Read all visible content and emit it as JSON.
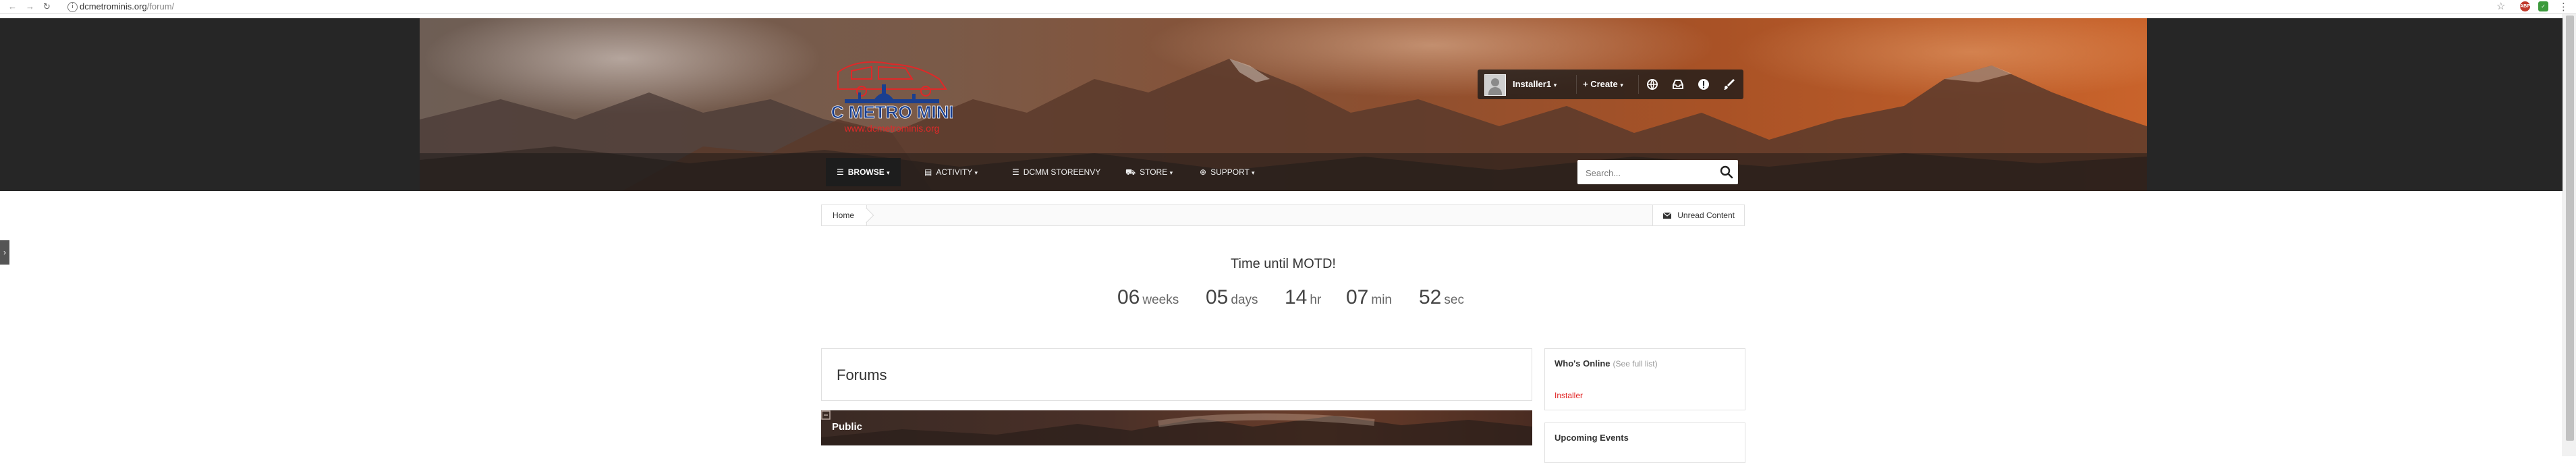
{
  "browser": {
    "url_domain": "dcmetrominis.org",
    "url_path": "/forum/",
    "ext_badge_red": "ABP",
    "ext_badge_green": "✓"
  },
  "header": {
    "logo_alt": "DC Metro Minis",
    "user_bar": {
      "username": "Installer1",
      "create_label": "Create"
    },
    "nav": [
      {
        "label": "Browse",
        "icon": "list-icon"
      },
      {
        "label": "Activity",
        "icon": "activity-icon"
      },
      {
        "label": "DCMM Storeenvy",
        "icon": "document-icon"
      },
      {
        "label": "Store",
        "icon": "cart-icon"
      },
      {
        "label": "Support",
        "icon": "lifebuoy-icon"
      }
    ],
    "search": {
      "placeholder": "Search..."
    }
  },
  "breadcrumb": {
    "home": "Home",
    "unread": "Unread Content"
  },
  "countdown": {
    "title": "Time until MOTD!",
    "weeks": {
      "value": "06",
      "unit": "weeks"
    },
    "days": {
      "value": "05",
      "unit": "days"
    },
    "hours": {
      "value": "14",
      "unit": "hr"
    },
    "minutes": {
      "value": "07",
      "unit": "min"
    },
    "seconds": {
      "value": "52",
      "unit": "sec"
    }
  },
  "forums": {
    "title": "Forums",
    "category": "Public"
  },
  "sidebar": {
    "online": {
      "title": "Who's Online",
      "see_full": "(See full list)",
      "users": [
        "Installer"
      ]
    },
    "events": {
      "title": "Upcoming Events"
    }
  },
  "colors": {
    "accent_red": "#e02020",
    "header_dark": "#262626",
    "hero_orange": "#c9632b"
  }
}
